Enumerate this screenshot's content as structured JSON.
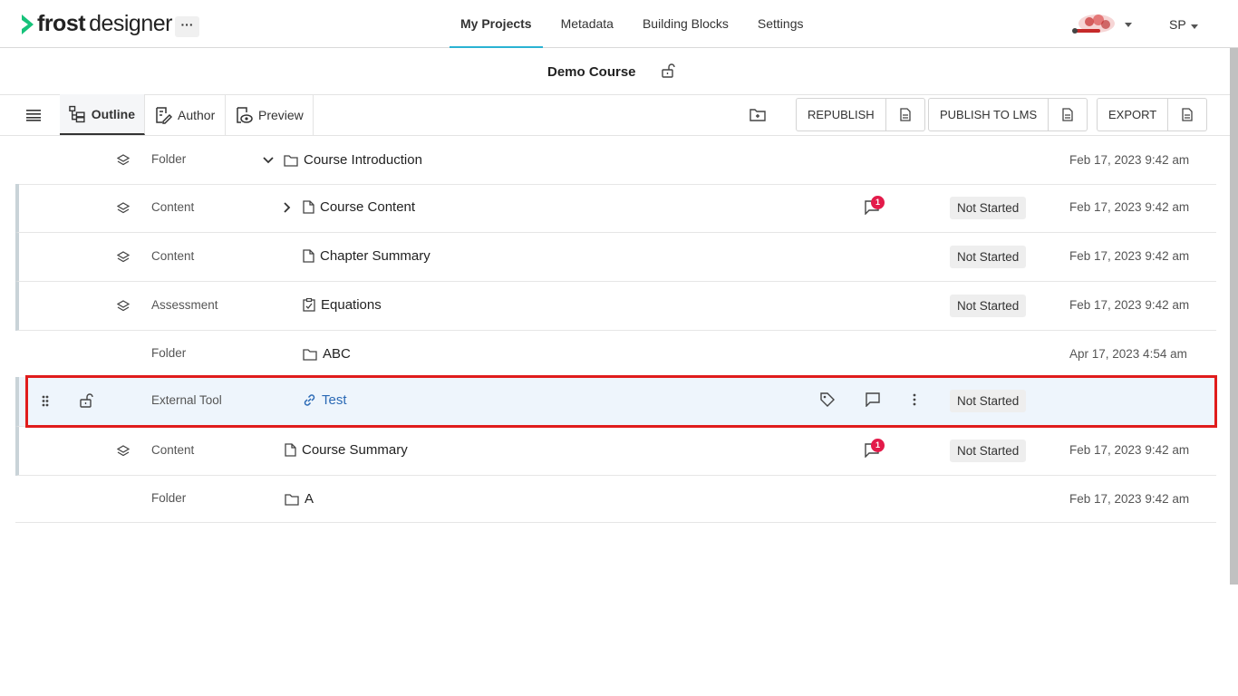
{
  "brand": {
    "word1": "frost",
    "word2": "designer",
    "more": "···"
  },
  "nav": [
    {
      "label": "My Projects",
      "active": true
    },
    {
      "label": "Metadata",
      "active": false
    },
    {
      "label": "Building Blocks",
      "active": false
    },
    {
      "label": "Settings",
      "active": false
    }
  ],
  "user": {
    "initials": "SP"
  },
  "course": {
    "title": "Demo Course"
  },
  "tabs": {
    "outline": "Outline",
    "author": "Author",
    "preview": "Preview"
  },
  "actions": {
    "republish": "REPUBLISH",
    "publish_lms": "PUBLISH TO LMS",
    "export": "EXPORT"
  },
  "colors": {
    "accent": "#2ab3d3",
    "highlight": "#e01c1c",
    "badge_red": "#e31b4a",
    "link": "#2a69b5"
  },
  "rows": [
    {
      "type": "Folder",
      "name": "Course Introduction",
      "icon": "folder-icon",
      "status": "",
      "date": "Feb 17, 2023 9:42 am"
    },
    {
      "type": "Content",
      "name": "Course Content",
      "icon": "document-icon",
      "status": "Not Started",
      "comments": "1",
      "date": "Feb 17, 2023 9:42 am"
    },
    {
      "type": "Content",
      "name": "Chapter Summary",
      "icon": "document-icon",
      "status": "Not Started",
      "date": "Feb 17, 2023 9:42 am"
    },
    {
      "type": "Assessment",
      "name": "Equations",
      "icon": "checklist-icon",
      "status": "Not Started",
      "date": "Feb 17, 2023 9:42 am"
    },
    {
      "type": "Folder",
      "name": "ABC",
      "icon": "folder-icon",
      "status": "",
      "date": "Apr 17, 2023 4:54 am"
    },
    {
      "type": "External Tool",
      "name": "Test",
      "icon": "link-icon",
      "status": "Not Started",
      "date": "",
      "selected": true
    },
    {
      "type": "Content",
      "name": "Course Summary",
      "icon": "document-icon",
      "status": "Not Started",
      "comments": "1",
      "date": "Feb 17, 2023 9:42 am"
    },
    {
      "type": "Folder",
      "name": "A",
      "icon": "folder-icon",
      "status": "",
      "date": "Feb 17, 2023 9:42 am"
    }
  ]
}
